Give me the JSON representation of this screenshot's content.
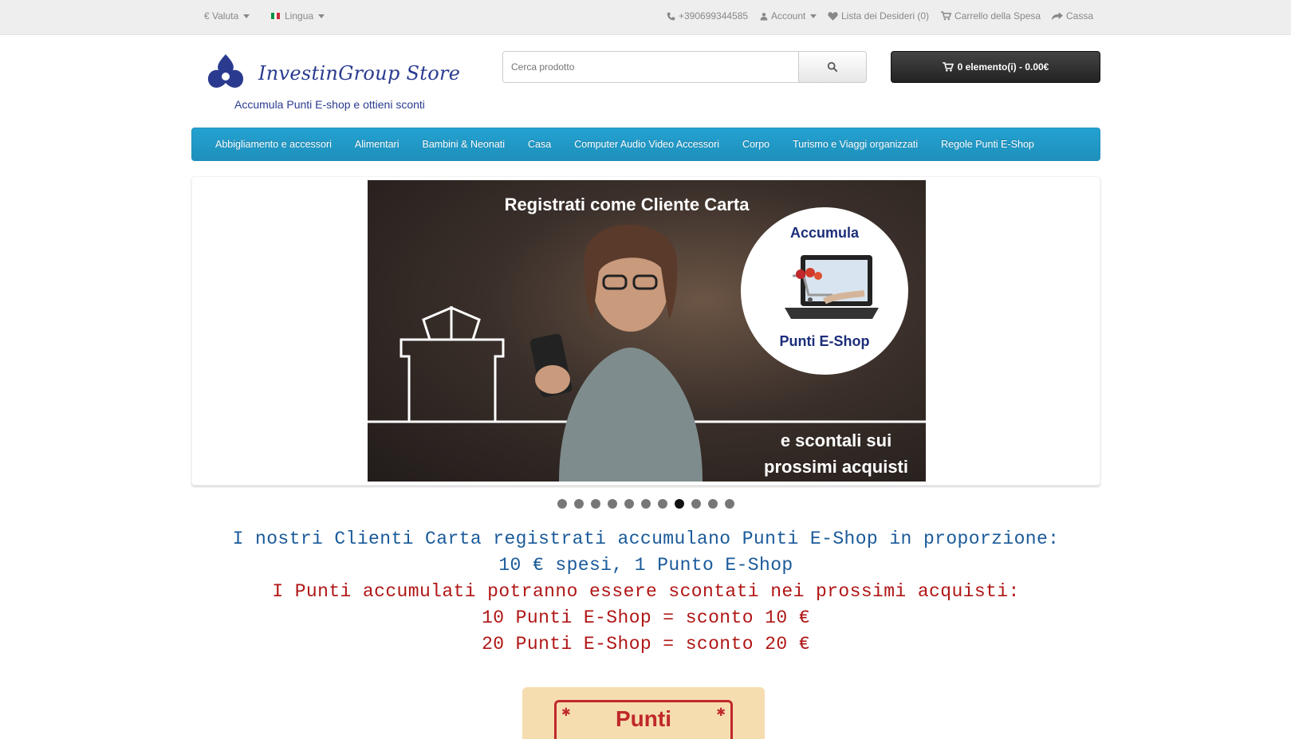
{
  "topbar": {
    "currency_label": "€ Valuta",
    "language_label": "Lingua",
    "phone": "+390699344585",
    "account_label": "Account",
    "wishlist_label": "Lista dei Desideri (0)",
    "cart_label": "Carrello della Spesa",
    "checkout_label": "Cassa"
  },
  "logo": {
    "title": "InvestinGroup Store",
    "tagline": "Accumula Punti E-shop e ottieni sconti"
  },
  "search": {
    "placeholder": "Cerca prodotto",
    "button_icon": "search-icon"
  },
  "cart": {
    "summary": "0 elemento(i) - 0.00€"
  },
  "nav": {
    "items": [
      "Abbigliamento e accessori",
      "Alimentari",
      "Bambini & Neonati",
      "Casa",
      "Computer Audio Video Accessori",
      "Corpo",
      "Turismo e Viaggi organizzati",
      "Regole Punti E-Shop"
    ]
  },
  "banner": {
    "title": "Registrati come Cliente Carta",
    "circle_top": "Accumula",
    "circle_bottom": "Punti E-Shop",
    "bottom_line1": "e scontali sui",
    "bottom_line2": "prossimi acquisti"
  },
  "slideshow": {
    "total_slides": 11,
    "active_slide": 8
  },
  "promo": {
    "line1": "I nostri Clienti Carta registrati accumulano Punti E-Shop in proporzione:",
    "line2": "10 € spesi, 1 Punto E-Shop",
    "line3": "I Punti accumulati potranno essere scontati nei prossimi acquisti:",
    "line4": "10 Punti E-Shop = sconto 10 €",
    "line5": "20 Punti E-Shop = sconto 20 €"
  },
  "ticket": {
    "text": "Punti"
  },
  "colors": {
    "nav_blue": "#229ac8",
    "promo_blue": "#1a5a9a",
    "promo_red": "#b01616",
    "brand_navy": "#2a3b8f"
  }
}
